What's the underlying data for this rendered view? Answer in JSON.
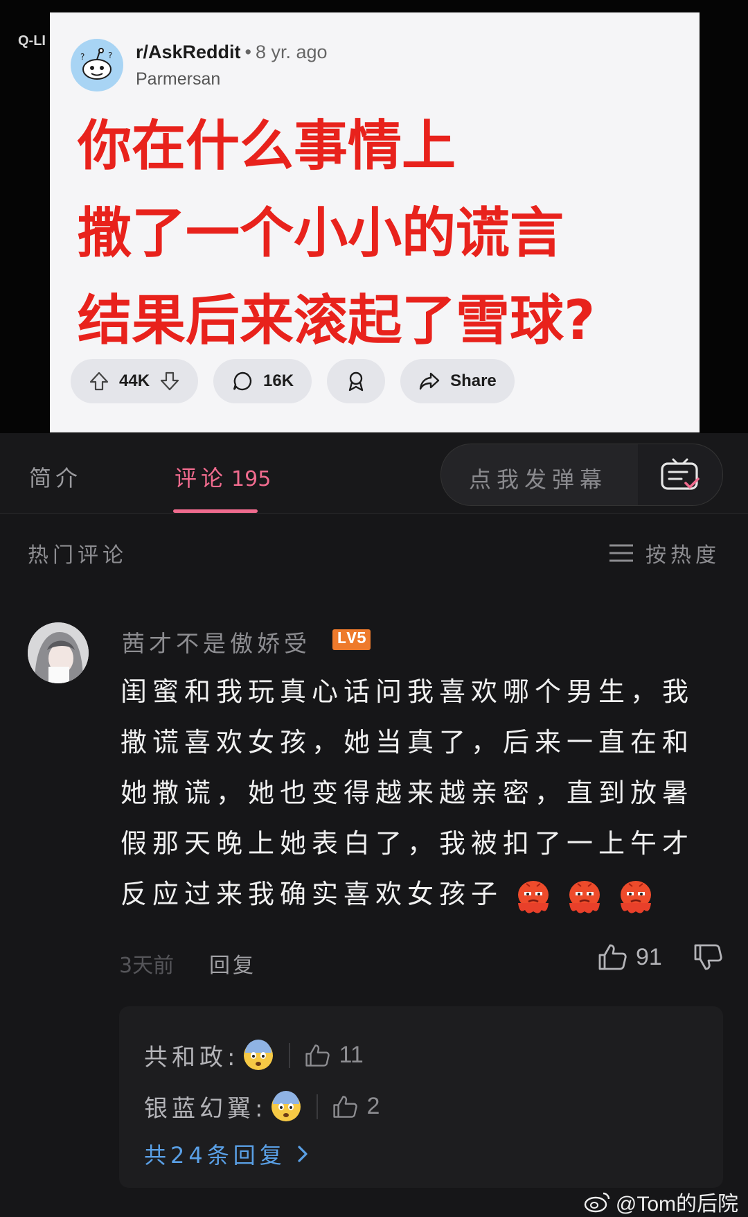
{
  "corner_mark": "Q-LI",
  "reddit": {
    "subreddit": "r/AskReddit",
    "separator": "•",
    "age": "8 yr. ago",
    "author": "Parmersan",
    "title_lines": [
      "你在什么事情上",
      "撒了一个小小的谎言",
      "结果后来滚起了雪球?"
    ],
    "upvotes": "44K",
    "comments": "16K",
    "share_label": "Share"
  },
  "tabs": {
    "intro": "简介",
    "comments": "评论",
    "comments_count": "195",
    "danmaku_placeholder": "点我发弹幕"
  },
  "comments_header": {
    "title": "热门评论",
    "sort_label": "按热度"
  },
  "comment": {
    "username": "茜才不是傲娇受",
    "level": "LV5",
    "lines": [
      "闺蜜和我玩真心话问我喜欢哪个男生，我",
      "撒谎喜欢女孩，她当真了，后来一直在和",
      "她撒谎，她也变得越来越亲密，直到放暑",
      "假那天晚上她表白了，我被扣了一上午才",
      "反应过来我确实喜欢女孩子"
    ],
    "time": "3天前",
    "reply_label": "回复",
    "likes": "91"
  },
  "replies": {
    "items": [
      {
        "name": "共和政:",
        "likes": "11"
      },
      {
        "name": "银蓝幻翼:",
        "likes": "2"
      }
    ],
    "more_label": "共24条回复"
  },
  "watermark": "@Tom的后院",
  "colors": {
    "title_red": "#e8221c",
    "pink": "#f06b8e",
    "link_blue": "#5aa0e6",
    "level_orange": "#ee7a2c"
  }
}
